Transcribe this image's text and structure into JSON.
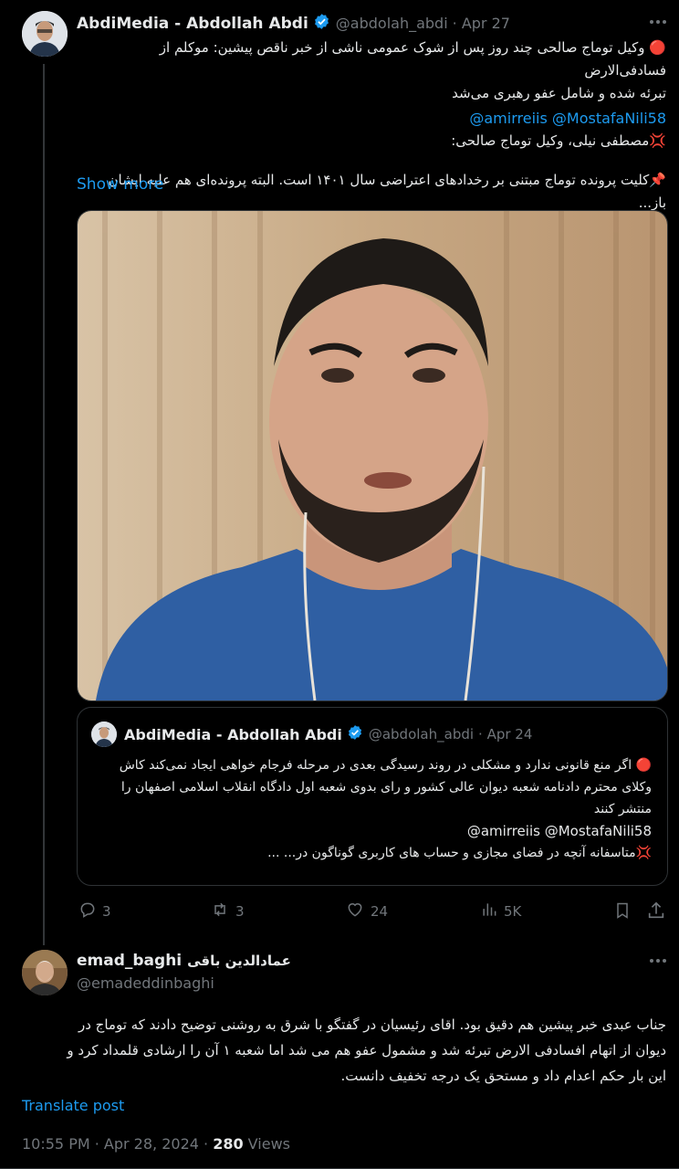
{
  "tweet": {
    "author_name": "AbdiMedia - Abdollah Abdi",
    "handle": "@abdolah_abdi",
    "date": "· Apr 27",
    "lines": [
      "🔴 وکیل توماج صالحی چند روز پس از شوک عمومی ناشی از خبر ناقص پیشین: موکلم از فسادفی‌الارض",
      "تبرئه شده و شامل عفو رهبری می‌شد",
      "@amirreiis @MostafaNili58",
      "💢مصطفی نیلی، وکیل توماج صالحی:",
      "📌کلیت پرونده توماج مبتنی بر رخدادهای اعتراضی سال ۱۴۰۱ است. البته پرونده‌ای هم علیه ایشان باز..."
    ],
    "show_more": "Show more"
  },
  "quote": {
    "author_name": "AbdiMedia - Abdollah Abdi",
    "handle": "@abdolah_abdi",
    "date": "· Apr 24",
    "lines": [
      "🔴 اگر منع قانونی ندارد و مشکلی در روند رسیدگی بعدی در مرحله فرجام خواهی ایجاد نمی‌کند کاش",
      "وکلای محترم دادنامه شعبه دیوان عالی کشور و رای بدوی شعبه اول دادگاه انقلاب اسلامی اصفهان را",
      "منتشر کنند",
      "@amirreiis @MostafaNili58",
      "💢متاسفانه آنچه در فضای مجازی و حساب های کاربری گوناگون در... ..."
    ]
  },
  "actions": {
    "replies": "3",
    "reposts": "3",
    "likes": "24",
    "views": "5K"
  },
  "reply": {
    "name_latin": "emad_baghi",
    "name_persian": "عمادالدین باقی",
    "handle": "@emadeddinbaghi",
    "lines": [
      "جناب عبدی خبر پیشین هم دقیق بود. اقای رئیسیان در گفتگو با شرق به روشنی توضیح دادند که توماج در",
      "دیوان از اتهام افسادفی الارض تبرئه شد و مشمول عفو هم می شد اما شعبه ۱ آن را ارشادی قلمداد کرد و",
      "این بار حکم اعدام داد و مستحق یک درجه تخفیف دانست."
    ],
    "translate": "Translate post",
    "timestamp": "10:55 PM · Apr 28, 2024 · ",
    "views_count": "280",
    "views_label": " Views"
  },
  "colors": {
    "accent": "#1d9bf0",
    "muted": "#71767b",
    "text": "#e7e9ea",
    "border": "#2f3336"
  },
  "icons": [
    "more-icon",
    "verified-badge-icon",
    "reply-icon",
    "repost-icon",
    "like-icon",
    "views-icon",
    "bookmark-icon",
    "share-icon"
  ]
}
